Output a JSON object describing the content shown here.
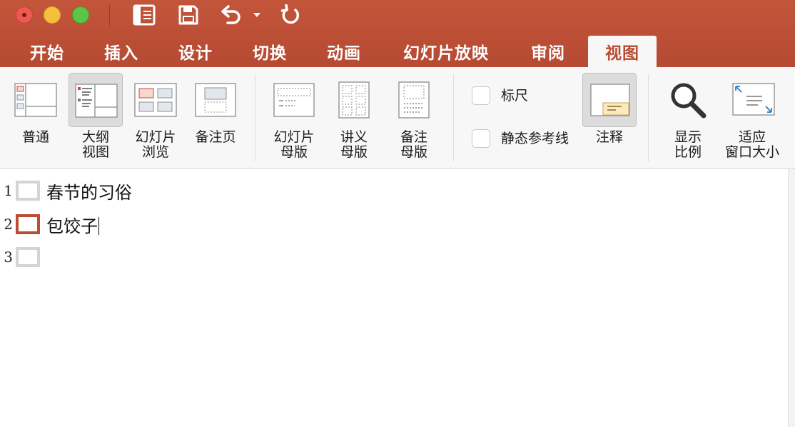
{
  "window": {
    "quick_access": [
      "sidebar-toggle-icon",
      "save-icon",
      "undo-icon",
      "dropdown-arrow-icon",
      "redo-icon"
    ]
  },
  "tabs": [
    {
      "label": "开始",
      "active": false
    },
    {
      "label": "插入",
      "active": false
    },
    {
      "label": "设计",
      "active": false
    },
    {
      "label": "切换",
      "active": false
    },
    {
      "label": "动画",
      "active": false
    },
    {
      "label": "幻灯片放映",
      "active": false
    },
    {
      "label": "审阅",
      "active": false
    },
    {
      "label": "视图",
      "active": true
    }
  ],
  "ribbon": {
    "views": {
      "normal": "普通",
      "outline_1": "大纲",
      "outline_2": "视图",
      "sorter_1": "幻灯片",
      "sorter_2": "浏览",
      "notes_page": "备注页"
    },
    "masters": {
      "slide_master_1": "幻灯片",
      "slide_master_2": "母版",
      "handout_master_1": "讲义",
      "handout_master_2": "母版",
      "notes_master_1": "备注",
      "notes_master_2": "母版"
    },
    "show": {
      "ruler": "标尺",
      "ruler_checked": false,
      "guides": "静态参考线",
      "guides_checked": false,
      "notes": "注释"
    },
    "zoom": {
      "zoom_1": "显示",
      "zoom_2": "比例",
      "fit_1": "适应",
      "fit_2": "窗口大小"
    }
  },
  "outline": {
    "slides": [
      {
        "number": "1",
        "title": "春节的习俗",
        "selected": false
      },
      {
        "number": "2",
        "title": "包饺子",
        "selected": true
      },
      {
        "number": "3",
        "title": "",
        "selected": false
      }
    ]
  },
  "colors": {
    "titlebar": "#b84b33",
    "accent": "#bd4c34",
    "ribbon_bg": "#f7f7f7"
  }
}
